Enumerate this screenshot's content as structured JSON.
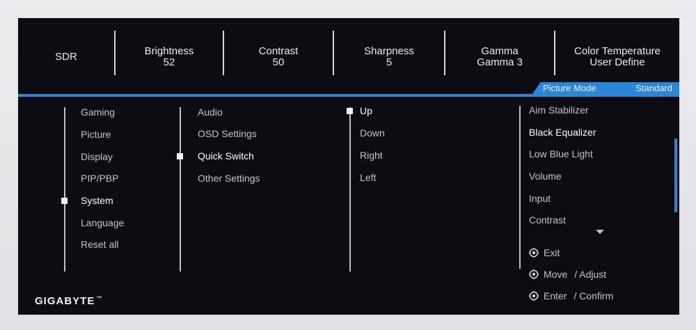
{
  "topbar": {
    "mode": "SDR",
    "brightness": {
      "label": "Brightness",
      "value": "52"
    },
    "contrast": {
      "label": "Contrast",
      "value": "50"
    },
    "sharpness": {
      "label": "Sharpness",
      "value": "5"
    },
    "gamma": {
      "label": "Gamma",
      "value": "Gamma 3"
    },
    "color_temp": {
      "label": "Color Temperature",
      "value": "User Define"
    }
  },
  "picture_mode": {
    "label": "Picture Mode",
    "value": "Standard"
  },
  "menu": {
    "col1": [
      "Gaming",
      "Picture",
      "Display",
      "PIP/PBP",
      "System",
      "Language",
      "Reset all"
    ],
    "col1_selected": "System",
    "col2": [
      "Audio",
      "OSD Settings",
      "Quick Switch",
      "Other Settings"
    ],
    "col2_selected": "Quick Switch",
    "col3": [
      "Up",
      "Down",
      "Right",
      "Left"
    ],
    "col3_selected": "Up",
    "col4": [
      "Aim Stabilizer",
      "Black Equalizer",
      "Low Blue Light",
      "Volume",
      "Input",
      "Contrast"
    ],
    "col4_highlighted": "Black Equalizer"
  },
  "help": {
    "exit": "Exit",
    "move": "Move",
    "adjust": "/ Adjust",
    "enter": "Enter",
    "confirm": "/ Confirm"
  },
  "brand": {
    "name": "GIGABYTE",
    "tm": "™"
  },
  "colors": {
    "accent": "#2a86d8",
    "background": "#0b0b11",
    "text": "#c4c4cc"
  }
}
